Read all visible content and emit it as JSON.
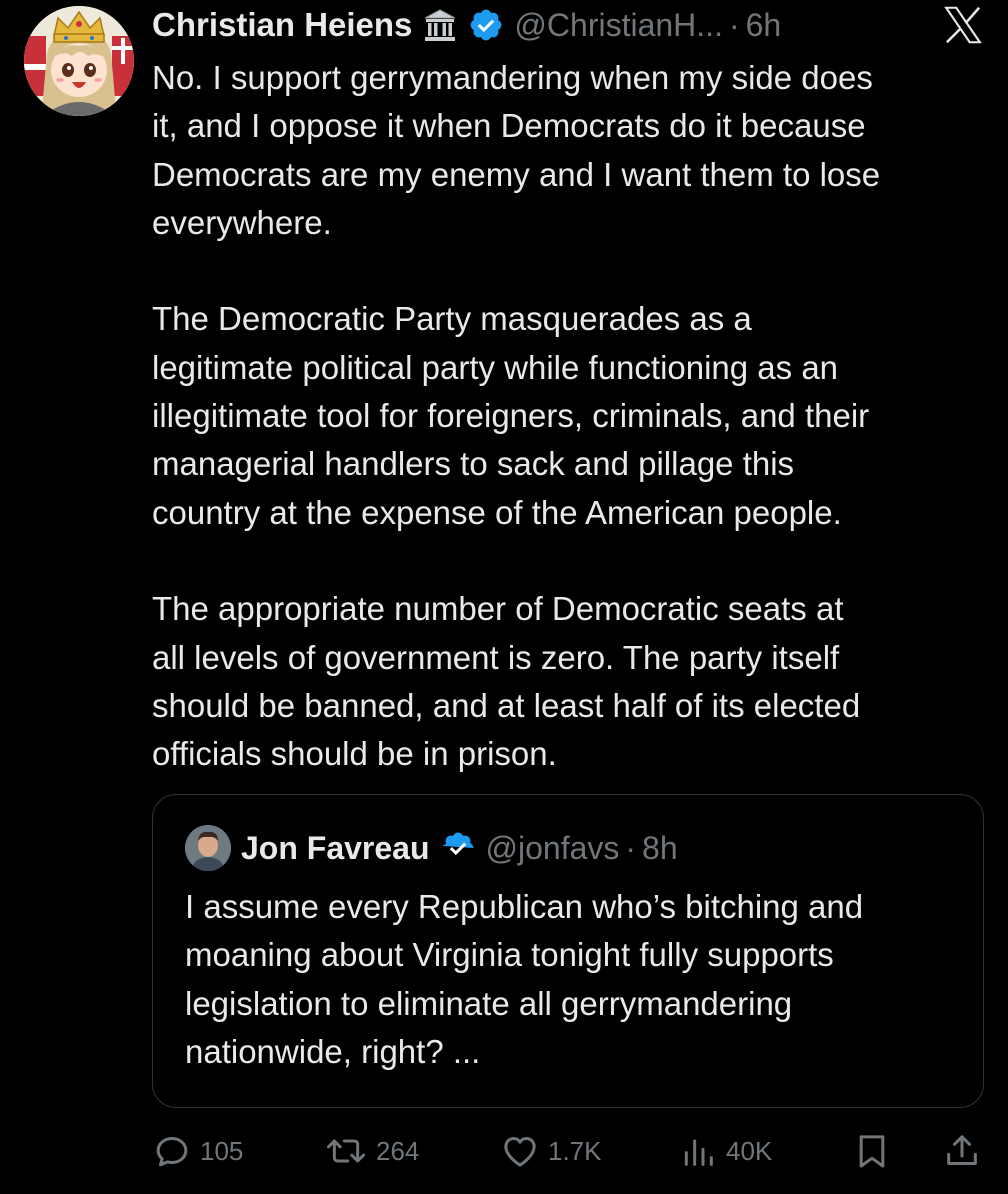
{
  "author": {
    "display_name": "Christian Heiens",
    "handle": "@ChristianH...",
    "separator": "·",
    "time": "6h"
  },
  "icons": {
    "badge": "classical-building-icon",
    "verified": "verified-badge-icon",
    "platform": "x-logo-icon"
  },
  "tweet": {
    "text": "No. I support gerrymandering when my side does\nit, and I oppose it when Democrats do it because\nDemocrats are my enemy and I want them to lose\neverywhere.\n\nThe Democratic Party masquerades as a\nlegitimate political party while functioning as an\nillegitimate tool for foreigners, criminals, and their\nmanagerial handlers to sack and pillage this\ncountry at the expense of the American people.\n\nThe appropriate number of Democratic seats at\nall levels of government is zero. The party itself\nshould be banned, and at least half of its elected\nofficials should be in prison."
  },
  "quote": {
    "display_name": "Jon Favreau",
    "handle": "@jonfavs",
    "separator": "·",
    "time": "8h",
    "text": "I assume every Republican who’s bitching and\nmoaning about Virginia tonight fully supports\nlegislation to eliminate all gerrymandering\nnationwide, right? ..."
  },
  "actions": {
    "reply_count": "105",
    "repost_count": "264",
    "like_count": "1.7K",
    "view_count": "40K"
  },
  "colors": {
    "background": "#000000",
    "text": "#e7e9ea",
    "muted": "#71767b",
    "border": "#2f3336",
    "verified": "#1d9bf0"
  }
}
